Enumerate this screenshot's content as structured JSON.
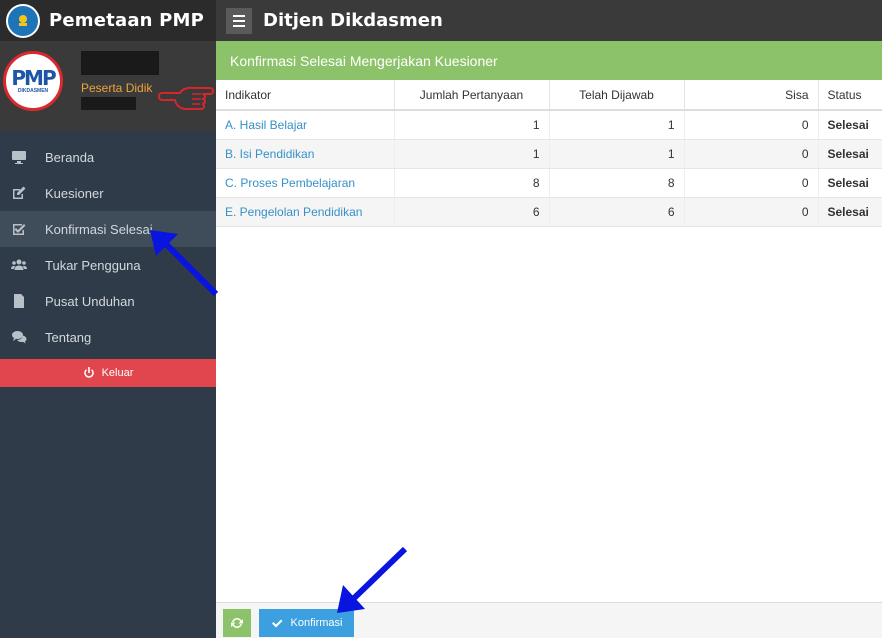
{
  "sidebar": {
    "brand_title": "Pemetaan PMP",
    "avatar_text": "PMP",
    "avatar_subtext": "DIKDASMEN",
    "role": "Peserta Didik",
    "items": [
      {
        "label": "Beranda",
        "icon": "desktop-icon"
      },
      {
        "label": "Kuesioner",
        "icon": "edit-icon"
      },
      {
        "label": "Konfirmasi Selesai",
        "icon": "checkbox-icon",
        "active": true
      },
      {
        "label": "Tukar Pengguna",
        "icon": "users-icon"
      },
      {
        "label": "Pusat Unduhan",
        "icon": "file-icon"
      },
      {
        "label": "Tentang",
        "icon": "comments-icon"
      }
    ],
    "logout_label": "Keluar"
  },
  "topbar": {
    "title": "Ditjen Dikdasmen"
  },
  "panel": {
    "title": "Konfirmasi Selesai Mengerjakan Kuesioner",
    "columns": [
      "Indikator",
      "Jumlah Pertanyaan",
      "Telah Dijawab",
      "Sisa",
      "Status"
    ],
    "rows": [
      {
        "indikator": "A. Hasil Belajar",
        "jumlah": "1",
        "dijawab": "1",
        "sisa": "0",
        "status": "Selesai"
      },
      {
        "indikator": "B. Isi Pendidikan",
        "jumlah": "1",
        "dijawab": "1",
        "sisa": "0",
        "status": "Selesai"
      },
      {
        "indikator": "C. Proses Pembelajaran",
        "jumlah": "8",
        "dijawab": "8",
        "sisa": "0",
        "status": "Selesai"
      },
      {
        "indikator": "E. Pengelolan Pendidikan",
        "jumlah": "6",
        "dijawab": "6",
        "sisa": "0",
        "status": "Selesai"
      }
    ]
  },
  "footer": {
    "confirm_label": "Konfirmasi"
  },
  "colors": {
    "sidebar_bg": "#2f3b48",
    "topbar_bg": "#3a3a3a",
    "panel_header": "#8cc36a",
    "logout": "#e0464b",
    "confirm": "#3b9fe0",
    "link": "#3591c8",
    "status_done": "#1f8a1f",
    "annotation_arrow": "#0a14e0",
    "annotation_hand": "#d6262c"
  }
}
